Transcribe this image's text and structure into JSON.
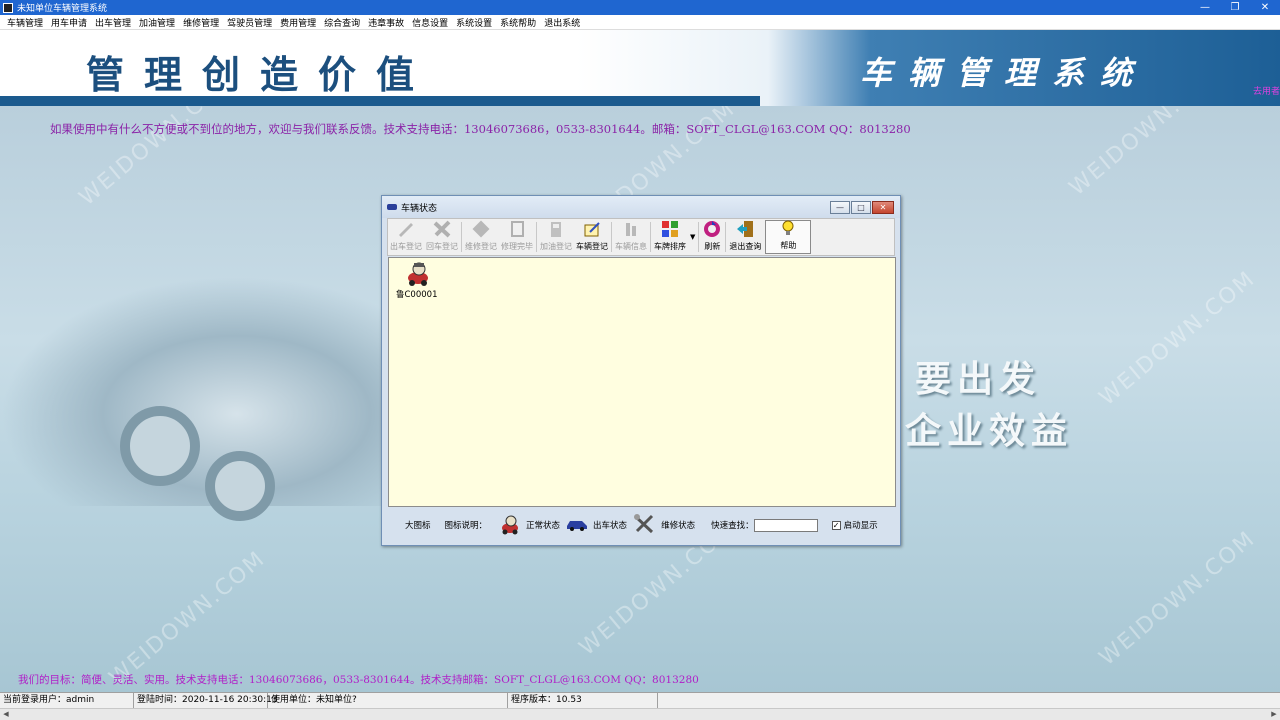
{
  "window": {
    "title": "未知单位车辆管理系统"
  },
  "menu": [
    "车辆管理",
    "用车申请",
    "出车管理",
    "加油管理",
    "维修管理",
    "驾驶员管理",
    "费用管理",
    "综合查询",
    "违章事故",
    "信息设置",
    "系统设置",
    "系统帮助",
    "退出系统"
  ],
  "banner": {
    "slogan": "管理创造价值",
    "system_name": "车辆管理系统",
    "side_tag": "去用者"
  },
  "notice_top": "如果使用中有什么不方便或不到位的地方，欢迎与我们联系反馈。技术支持电话：13046073686，0533-8301644。邮箱：SOFT_CLGL@163.COM QQ：8013280",
  "motto": {
    "line1": "要出发",
    "line2": "企业效益"
  },
  "dialog": {
    "title": "车辆状态",
    "toolbar": [
      {
        "label": "出车登记",
        "enabled": false
      },
      {
        "label": "回车登记",
        "enabled": false
      },
      {
        "label": "维修登记",
        "enabled": false
      },
      {
        "label": "修理完毕",
        "enabled": false
      },
      {
        "label": "加油登记",
        "enabled": false
      },
      {
        "label": "车辆登记",
        "enabled": true
      },
      {
        "label": "车辆信息",
        "enabled": false
      },
      {
        "label": "车牌排序",
        "enabled": true
      },
      {
        "label": "刷新",
        "enabled": true
      },
      {
        "label": "退出查询",
        "enabled": true
      },
      {
        "label": "帮助",
        "enabled": true
      }
    ],
    "vehicles": [
      {
        "plate": "鲁C00001",
        "icon": "normal-status-car-icon"
      }
    ],
    "legend": {
      "view_label": "大图标",
      "icon_desc_label": "图标说明：",
      "normal_label": "正常状态",
      "out_label": "出车状态",
      "repair_label": "维修状态",
      "search_label": "快速查找：",
      "search_value": "",
      "auto_show_label": "启动显示",
      "auto_show_checked": true
    }
  },
  "notice_bottom": "我们的目标：简便、灵活、实用。技术支持电话：13046073686，0533-8301644。技术支持邮箱：SOFT_CLGL@163.COM QQ：8013280",
  "statusbar": {
    "user": "当前登录用户：admin",
    "login_time": "登陆时间：2020-11-16 20:30:13",
    "unit": "使用单位：未知单位?",
    "version": "程序版本：10.53"
  },
  "watermark": "WEIDOWN.COM"
}
